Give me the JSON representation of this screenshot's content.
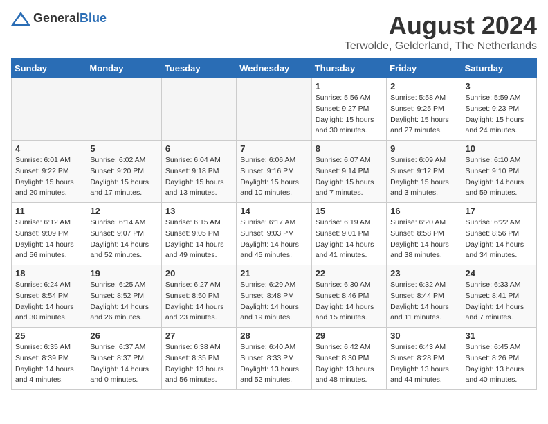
{
  "logo": {
    "text_general": "General",
    "text_blue": "Blue"
  },
  "title": "August 2024",
  "subtitle": "Terwolde, Gelderland, The Netherlands",
  "days_of_week": [
    "Sunday",
    "Monday",
    "Tuesday",
    "Wednesday",
    "Thursday",
    "Friday",
    "Saturday"
  ],
  "weeks": [
    [
      {
        "day": "",
        "info": ""
      },
      {
        "day": "",
        "info": ""
      },
      {
        "day": "",
        "info": ""
      },
      {
        "day": "",
        "info": ""
      },
      {
        "day": "1",
        "info": "Sunrise: 5:56 AM\nSunset: 9:27 PM\nDaylight: 15 hours and 30 minutes."
      },
      {
        "day": "2",
        "info": "Sunrise: 5:58 AM\nSunset: 9:25 PM\nDaylight: 15 hours and 27 minutes."
      },
      {
        "day": "3",
        "info": "Sunrise: 5:59 AM\nSunset: 9:23 PM\nDaylight: 15 hours and 24 minutes."
      }
    ],
    [
      {
        "day": "4",
        "info": "Sunrise: 6:01 AM\nSunset: 9:22 PM\nDaylight: 15 hours and 20 minutes."
      },
      {
        "day": "5",
        "info": "Sunrise: 6:02 AM\nSunset: 9:20 PM\nDaylight: 15 hours and 17 minutes."
      },
      {
        "day": "6",
        "info": "Sunrise: 6:04 AM\nSunset: 9:18 PM\nDaylight: 15 hours and 13 minutes."
      },
      {
        "day": "7",
        "info": "Sunrise: 6:06 AM\nSunset: 9:16 PM\nDaylight: 15 hours and 10 minutes."
      },
      {
        "day": "8",
        "info": "Sunrise: 6:07 AM\nSunset: 9:14 PM\nDaylight: 15 hours and 7 minutes."
      },
      {
        "day": "9",
        "info": "Sunrise: 6:09 AM\nSunset: 9:12 PM\nDaylight: 15 hours and 3 minutes."
      },
      {
        "day": "10",
        "info": "Sunrise: 6:10 AM\nSunset: 9:10 PM\nDaylight: 14 hours and 59 minutes."
      }
    ],
    [
      {
        "day": "11",
        "info": "Sunrise: 6:12 AM\nSunset: 9:09 PM\nDaylight: 14 hours and 56 minutes."
      },
      {
        "day": "12",
        "info": "Sunrise: 6:14 AM\nSunset: 9:07 PM\nDaylight: 14 hours and 52 minutes."
      },
      {
        "day": "13",
        "info": "Sunrise: 6:15 AM\nSunset: 9:05 PM\nDaylight: 14 hours and 49 minutes."
      },
      {
        "day": "14",
        "info": "Sunrise: 6:17 AM\nSunset: 9:03 PM\nDaylight: 14 hours and 45 minutes."
      },
      {
        "day": "15",
        "info": "Sunrise: 6:19 AM\nSunset: 9:01 PM\nDaylight: 14 hours and 41 minutes."
      },
      {
        "day": "16",
        "info": "Sunrise: 6:20 AM\nSunset: 8:58 PM\nDaylight: 14 hours and 38 minutes."
      },
      {
        "day": "17",
        "info": "Sunrise: 6:22 AM\nSunset: 8:56 PM\nDaylight: 14 hours and 34 minutes."
      }
    ],
    [
      {
        "day": "18",
        "info": "Sunrise: 6:24 AM\nSunset: 8:54 PM\nDaylight: 14 hours and 30 minutes."
      },
      {
        "day": "19",
        "info": "Sunrise: 6:25 AM\nSunset: 8:52 PM\nDaylight: 14 hours and 26 minutes."
      },
      {
        "day": "20",
        "info": "Sunrise: 6:27 AM\nSunset: 8:50 PM\nDaylight: 14 hours and 23 minutes."
      },
      {
        "day": "21",
        "info": "Sunrise: 6:29 AM\nSunset: 8:48 PM\nDaylight: 14 hours and 19 minutes."
      },
      {
        "day": "22",
        "info": "Sunrise: 6:30 AM\nSunset: 8:46 PM\nDaylight: 14 hours and 15 minutes."
      },
      {
        "day": "23",
        "info": "Sunrise: 6:32 AM\nSunset: 8:44 PM\nDaylight: 14 hours and 11 minutes."
      },
      {
        "day": "24",
        "info": "Sunrise: 6:33 AM\nSunset: 8:41 PM\nDaylight: 14 hours and 7 minutes."
      }
    ],
    [
      {
        "day": "25",
        "info": "Sunrise: 6:35 AM\nSunset: 8:39 PM\nDaylight: 14 hours and 4 minutes."
      },
      {
        "day": "26",
        "info": "Sunrise: 6:37 AM\nSunset: 8:37 PM\nDaylight: 14 hours and 0 minutes."
      },
      {
        "day": "27",
        "info": "Sunrise: 6:38 AM\nSunset: 8:35 PM\nDaylight: 13 hours and 56 minutes."
      },
      {
        "day": "28",
        "info": "Sunrise: 6:40 AM\nSunset: 8:33 PM\nDaylight: 13 hours and 52 minutes."
      },
      {
        "day": "29",
        "info": "Sunrise: 6:42 AM\nSunset: 8:30 PM\nDaylight: 13 hours and 48 minutes."
      },
      {
        "day": "30",
        "info": "Sunrise: 6:43 AM\nSunset: 8:28 PM\nDaylight: 13 hours and 44 minutes."
      },
      {
        "day": "31",
        "info": "Sunrise: 6:45 AM\nSunset: 8:26 PM\nDaylight: 13 hours and 40 minutes."
      }
    ]
  ]
}
